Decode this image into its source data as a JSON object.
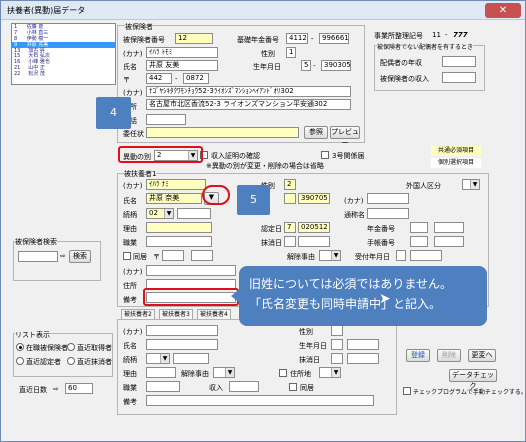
{
  "window": {
    "title": "扶養者(異動)届データ",
    "close_label": "✕"
  },
  "list": {
    "rows": [
      "1      佐藤 豊",
      "7      小林 直三",
      "8      伊勢 樹一",
      "9      井原 充美",
      "13     加古 昇",
      "15     大石 弘次",
      "16     小峰 雅也",
      "21     山中 正",
      "22     松沢 茂"
    ],
    "selected_index": 3
  },
  "insured": {
    "section_label": "被保険者",
    "number_label": "被保険者番号",
    "number_value": "12",
    "pension_label": "基礎年金番号",
    "pension_1": "4112",
    "pension_dash": "-",
    "pension_2": "996661",
    "kana_label": "(カナ)",
    "kana_value": "ｲﾊﾗ ﾄﾓﾐ",
    "gender_label": "性別",
    "gender_value": "1",
    "name_label": "氏名",
    "name_value": "井原 友美",
    "birth_label": "生年月日",
    "birth_era": "5",
    "birth_value": "390305",
    "postal_symbol": "〒",
    "postal_1": "442",
    "postal_2": "0872",
    "kana_addr_label": "(カナ)",
    "kana_addr_value": "ﾅｺﾞﾔｼｷﾀｸﾜﾓﾝﾁｮｳ52-3ﾗｲｵﾝｽﾞﾏﾝｼｮﾝﾍｲｱﾝﾄﾞｵﾘ302",
    "address_label": "住所",
    "address_value": "名古屋市北区香流52-3 ライオンズマンション平安通302",
    "phone_label": "電話",
    "delegate_label": "委任状",
    "browse_label": "参照",
    "preview_label": "プレビュー"
  },
  "office": {
    "code_label": "事業所整理記号",
    "code_1": "11",
    "code_dash": "-",
    "code_2": "777",
    "spouse_group": "被保険者でない配偶者を有するとき",
    "spouse_income_label": "配偶者の年収",
    "spouse_pension_label": "被保険者の収入"
  },
  "change_type": {
    "label": "異動の別",
    "value": "2",
    "proof_label": "収入証明の確認",
    "note": "※異動の別が変更・削除の場合は省略",
    "stage3_label": "3号関係届",
    "common_item": "共通必須項目",
    "individual_item": "個別選択項目"
  },
  "dependent": {
    "section_label": "被扶養者1",
    "kana_label": "(カナ)",
    "kana_value": "ｲﾊﾗ ﾅﾐ",
    "gender_label": "性別",
    "gender_value": "2",
    "foreign_label": "外国人区分",
    "name_label": "氏名",
    "name_value": "井原 奈美",
    "birth_value": "390705",
    "kana2_label": "(カナ)",
    "relation_label": "続柄",
    "relation_value": "02",
    "alias_label": "通称名",
    "reason_label": "理由",
    "cert_label": "認定日",
    "cert_era": "7",
    "cert_value": "020512",
    "annual_income_label": "年金番号",
    "job_label": "職業",
    "loss_label": "抹消日",
    "handbook_label": "手帳番号",
    "same_label": "同居",
    "postal_symbol": "〒",
    "cancel_reason_label": "解除事由",
    "receive_label": "受付年月日",
    "kana3_label": "(カナ)",
    "address_label": "住所",
    "remarks_label": "備考"
  },
  "tabs": [
    "被扶養者2",
    "被扶養者3",
    "被扶養者4"
  ],
  "dependent2": {
    "kana_label": "(カナ)",
    "gender_label": "性別",
    "name_label": "氏名",
    "birth_label": "生年月日",
    "relation_label": "続柄",
    "cert_label": "認定日",
    "loss_label": "抹消日",
    "reason_label": "理由",
    "cancel_label": "解除事由",
    "live_label": "住所地",
    "job_label": "職業",
    "income_label": "収入",
    "same_label": "同居",
    "remarks_label": "備考"
  },
  "search": {
    "group_label": "被保険者検索",
    "button": "検索",
    "arrow": "⇨"
  },
  "display": {
    "group_label": "リスト表示",
    "opt1": "在職被保険者",
    "opt2": "直近取得者",
    "opt3": "直近認定者",
    "opt4": "直近抹消者",
    "days_label": "直近日数",
    "days_arrow": "⇨",
    "days_value": "60"
  },
  "actions": {
    "register": "登録",
    "delete": "削除",
    "change": "更変へ",
    "data_check": "データチェック",
    "auto_check": "チェックプログラムで手動チェックする。"
  },
  "annotations": {
    "badge4": "4",
    "badge5": "5",
    "callout_line1": "旧姓については必須ではありません。",
    "callout_line2": "「氏名変更も同時申請中」と記入。"
  },
  "colors": {
    "accent": "#4e7fbf",
    "highlight": "#e0101a"
  }
}
